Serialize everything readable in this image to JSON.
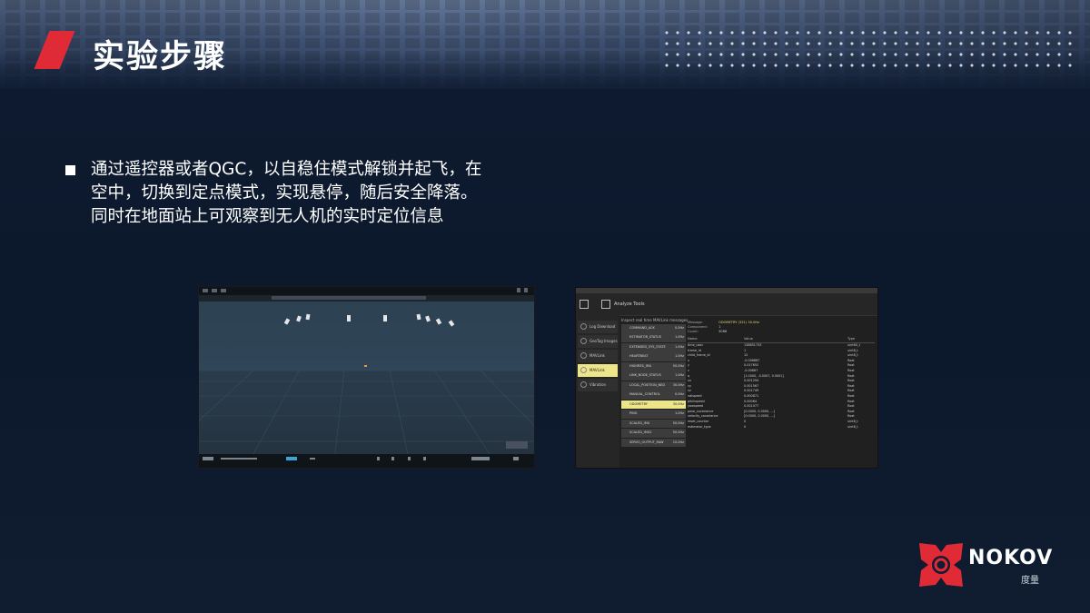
{
  "slide": {
    "title": "实验步骤",
    "bullet_text": "通过遥控器或者QGC，以自稳住模式解锁并起飞，在空中，切换到定点模式，实现悬停，随后安全降落。同时在地面站上可观察到无人机的实时定位信息"
  },
  "analysis_tool": {
    "header_label": "Analyze Tools",
    "sidebar": [
      {
        "label": "Log Download",
        "selected": false
      },
      {
        "label": "GeoTag Images",
        "selected": false
      },
      {
        "label": "MAVLink Console",
        "selected": false
      },
      {
        "label": "MAVLink Inspector",
        "selected": true
      },
      {
        "label": "Vibration",
        "selected": false
      }
    ],
    "hint": "Inspect real time MAVLink messages.",
    "messages": [
      {
        "name": "COMMAND_ACK",
        "count": "0.0Hz",
        "selected": false
      },
      {
        "name": "ESTIMATOR_STATUS",
        "count": "1.0Hz",
        "selected": false
      },
      {
        "name": "EXTENDED_SYS_STATE",
        "count": "1.0Hz",
        "selected": false
      },
      {
        "name": "HEARTBEAT",
        "count": "1.0Hz",
        "selected": false
      },
      {
        "name": "HIGHRES_IMU",
        "count": "50.0Hz",
        "selected": false
      },
      {
        "name": "LINK_NODE_STATUS",
        "count": "1.0Hz",
        "selected": false
      },
      {
        "name": "LOCAL_POSITION_NED",
        "count": "30.0Hz",
        "selected": false
      },
      {
        "name": "MANUAL_CONTROL",
        "count": "0.0Hz",
        "selected": false
      },
      {
        "name": "ODOMETRY",
        "count": "30.0Hz",
        "selected": true
      },
      {
        "name": "PING",
        "count": "1.0Hz",
        "selected": false
      },
      {
        "name": "SCALED_IMU",
        "count": "50.0Hz",
        "selected": false
      },
      {
        "name": "SCALED_IMU2",
        "count": "50.0Hz",
        "selected": false
      },
      {
        "name": "SERVO_OUTPUT_RAW",
        "count": "10.0Hz",
        "selected": false
      }
    ],
    "meta": [
      {
        "key": "Message:",
        "value": "ODOMETRY (331) 30.0Hz",
        "highlight": true
      },
      {
        "key": "Component:",
        "value": "1",
        "highlight": false
      },
      {
        "key": "Count:",
        "value": "3086",
        "highlight": false
      }
    ],
    "columns": [
      "Name",
      "Value",
      "Type"
    ],
    "fields": [
      [
        "time_usec",
        "138851733",
        "uint64_t"
      ],
      [
        "frame_id",
        "1",
        "uint8_t"
      ],
      [
        "child_frame_id",
        "12",
        "uint8_t"
      ],
      [
        "x",
        "-0.006887",
        "float"
      ],
      [
        "y",
        "0.017652",
        "float"
      ],
      [
        "z",
        "-0.00687",
        "float"
      ],
      [
        "q",
        "[1.0000, -0.0007, 0.0001]",
        "float"
      ],
      [
        "vx",
        "0.001294",
        "float"
      ],
      [
        "vy",
        "0.001567",
        "float"
      ],
      [
        "vz",
        "0.001749",
        "float"
      ],
      [
        "rollspeed",
        "0.000871",
        "float"
      ],
      [
        "pitchspeed",
        "0.00064",
        "float"
      ],
      [
        "yawspeed",
        "0.001077",
        "float"
      ],
      [
        "pose_covariance",
        "[0.0000, 0.0000, ...]",
        "float"
      ],
      [
        "velocity_covariance",
        "[0.0000, 0.0000, ...]",
        "float"
      ],
      [
        "reset_counter",
        "0",
        "uint8_t"
      ],
      [
        "estimator_type",
        "0",
        "uint8_t"
      ]
    ]
  },
  "logo": {
    "brand": "NOKOV",
    "sub": "度量",
    "color": "#e02a36"
  }
}
